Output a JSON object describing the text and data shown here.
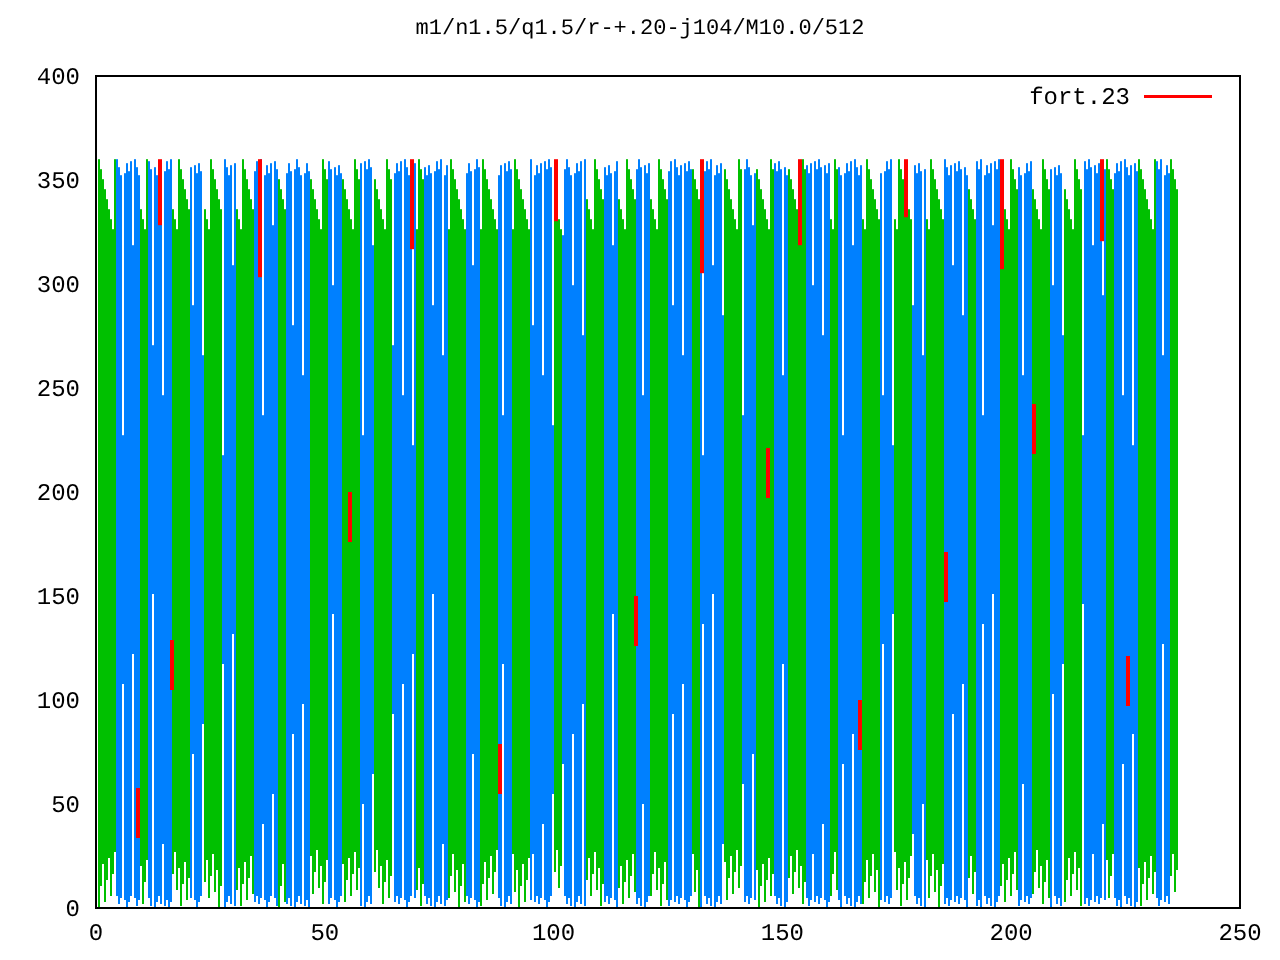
{
  "title": "m1/n1.5/q1.5/r-+.20-j104/M10.0/512",
  "legend": [
    {
      "label": "fort.23",
      "color": "#ff0000"
    }
  ],
  "y_ticks": [
    "400",
    "350",
    "300",
    "250",
    "200",
    "150",
    "100",
    "50",
    "0"
  ],
  "x_ticks": [
    "0",
    "50",
    "100",
    "150",
    "200",
    "250"
  ]
}
